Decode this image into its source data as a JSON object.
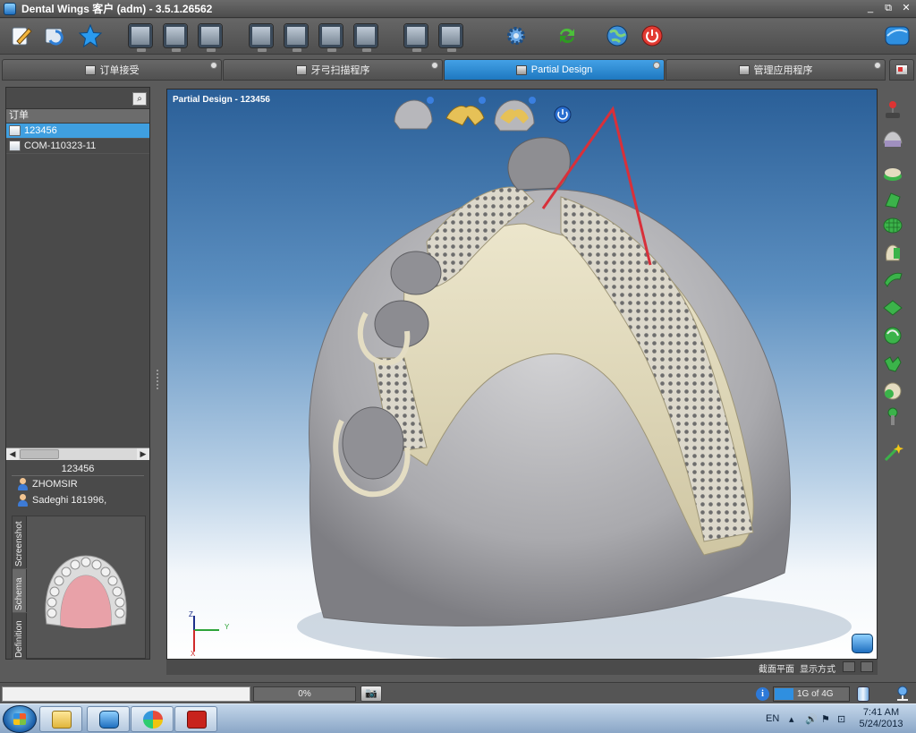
{
  "window": {
    "title": "Dental Wings 客户 (adm) - 3.5.1.26562"
  },
  "window_controls": {
    "minimize": "_",
    "restore": "⧉",
    "close": "✕"
  },
  "toolbar": {
    "icons": [
      "edit-order-icon",
      "refresh-icon",
      "star-icon",
      "monitor-scan-icon",
      "monitor-scan-2-icon",
      "monitor-scan-3-icon",
      "monitor-design-1-icon",
      "monitor-design-2-icon",
      "monitor-design-3-icon",
      "monitor-design-4-icon",
      "monitor-house-icon",
      "monitor-export-icon",
      "settings-gear-icon",
      "sync-icon",
      "globe-icon",
      "power-icon",
      "app-logo-icon"
    ]
  },
  "tabs": [
    {
      "label": "订单接受",
      "active": false
    },
    {
      "label": "牙弓扫描程序",
      "active": false
    },
    {
      "label": "Partial Design",
      "active": true
    },
    {
      "label": "管理应用程序",
      "active": false
    }
  ],
  "left_panel": {
    "orders_header": "订单",
    "orders": [
      {
        "label": "123456",
        "selected": true
      },
      {
        "label": "COM-110323-11",
        "selected": false
      }
    ],
    "case": {
      "title": "123456",
      "persons": [
        "ZHOMSIR",
        "Sadeghi 181996,"
      ]
    },
    "side_tabs": [
      "Screenshot",
      "Schema",
      "Definition"
    ]
  },
  "viewport": {
    "title": "Partial Design  - 123456",
    "footer": {
      "section_plane": "截面平面",
      "display_mode": "显示方式"
    },
    "axis": {
      "z": "Z",
      "y": "Y",
      "x": "X"
    }
  },
  "status": {
    "progress_text": "0%",
    "memory_text": "1G of 4G",
    "memory_fraction": 0.25
  },
  "taskbar": {
    "lang": "EN",
    "time": "7:41 AM",
    "date": "5/24/2013"
  },
  "colors": {
    "accent": "#2f8fe0",
    "framework": "#d9d2b5",
    "model": "#a8a8ab",
    "annotation": "#d8303a"
  }
}
